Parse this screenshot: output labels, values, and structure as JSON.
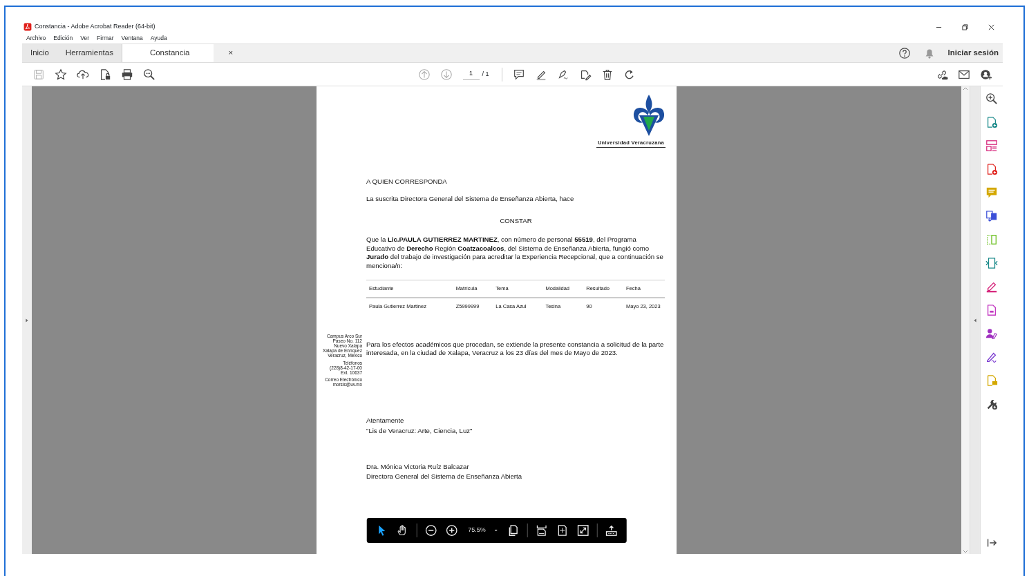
{
  "window": {
    "title": "Constancia - Adobe Acrobat Reader (64-bit)"
  },
  "menu": [
    "Archivo",
    "Edición",
    "Ver",
    "Firmar",
    "Ventana",
    "Ayuda"
  ],
  "tabs": [
    {
      "label": "Inicio",
      "selected": false,
      "kind": "home"
    },
    {
      "label": "Herramientas",
      "selected": false,
      "kind": "home"
    },
    {
      "label": "Constancia",
      "selected": true,
      "kind": "document",
      "close": "×"
    }
  ],
  "account": {
    "sign_in": "Iniciar sesión"
  },
  "toolbar": {
    "page": "1",
    "page_total": "/ 1"
  },
  "zoom_bar": {
    "zoom": "75.5%",
    "tools": [
      {
        "kind": "pointer",
        "selected": true
      },
      {
        "kind": "hand",
        "selected": false
      }
    ]
  },
  "document": {
    "logo_caption": "Universidad Veracruzana",
    "greeting": "A QUIEN CORRESPONDA",
    "intro": "La suscrita Directora General del Sistema de Enseñanza Abierta, hace",
    "heading": "CONSTAR",
    "body": "Que la **Lic.PAULA GUTIERREZ MARTINEZ**, con número de personal  **55519**, del Programa Educativo de **Derecho** Región **Coatzacoalcos**, del Sistema de Enseñanza Abierta, fungió como  **Jurado** del trabajo de investigación para acreditar la Experiencia Recepcional, que a continuación se menciona/n:",
    "table": {
      "columns": [
        "Estudiante",
        "Matrícula",
        "Tema",
        "Modalidad",
        "Resultado",
        "Fecha"
      ],
      "rows": [
        [
          "Paula Gutierrez Martinez",
          "Z5999999",
          "La Casa Azul",
          "Tesina",
          "90",
          "Mayo 23, 2023"
        ]
      ]
    },
    "address": [
      "Campus Arco Sur",
      "Paseo No. 112",
      "Nuevo Xalapa",
      "Xalapa de Enríquez",
      "Veracruz, México",
      "Teléfonos",
      "(228)8-42-17-00",
      "Ext. 10637",
      "Correo Electrónico",
      "morsis@uv.mx"
    ],
    "closing": "Para los efectos académicos que procedan, se extiende la presente constancia a solicitud de la parte interesada, en la ciudad de Xalapa, Veracruz a los 23 días del mes de Mayo de 2023.",
    "farewell": "Atentamente",
    "motto": "\"Lis de Veracruz: Arte, Ciencia, Luz\"",
    "signer": "Dra. Mónica Victoria Ruíz Balcazar",
    "signer_title": "Directora General del Sistema de Enseñanza Abierta"
  }
}
